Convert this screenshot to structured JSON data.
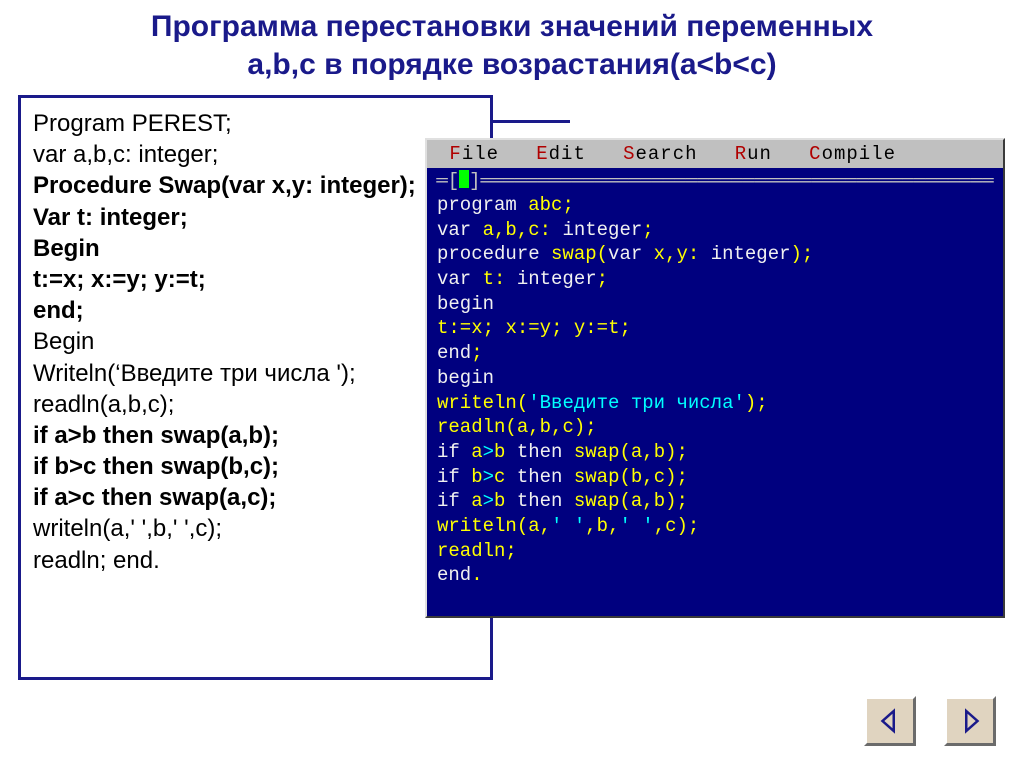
{
  "title_line1": "Программа перестановки значений переменных",
  "title_line2": "a,b,c в порядке возрастания(a<b<c)",
  "left_code": [
    {
      "text": "Program PEREST;",
      "bold": false
    },
    {
      "text": "var a,b,c: integer;",
      "bold": false
    },
    {
      "text": "Procedure Swap(var x,y: integer);",
      "bold": true
    },
    {
      "text": "Var t: integer;",
      "bold": true
    },
    {
      "text": "Begin",
      "bold": true
    },
    {
      "text": "t:=x; x:=y; y:=t;",
      "bold": true
    },
    {
      "text": "end;",
      "bold": true
    },
    {
      "text": "Begin",
      "bold": false
    },
    {
      "text": "Writeln(‘Введите три числа ');",
      "bold": false
    },
    {
      "text": "readln(a,b,c);",
      "bold": false
    },
    {
      "text": "if a>b then swap(a,b);",
      "bold": true
    },
    {
      "text": "if b>c then swap(b,c);",
      "bold": true
    },
    {
      "text": "if a>c then swap(a,c);",
      "bold": true
    },
    {
      "text": "writeln(a,' ',b,' ',c);",
      "bold": false
    },
    {
      "text": "readln;  end.",
      "bold": false
    }
  ],
  "ide": {
    "menu": [
      "File",
      "Edit",
      "Search",
      "Run",
      "Compile"
    ],
    "frame_char": "═",
    "cursor_glyph": " ",
    "lines": [
      [
        [
          "kw",
          "program "
        ],
        [
          "id",
          "abc"
        ],
        [
          "sym",
          ";"
        ]
      ],
      [
        [
          "kw",
          "var "
        ],
        [
          "id",
          "a"
        ],
        [
          "sym",
          ","
        ],
        [
          "id",
          "b"
        ],
        [
          "sym",
          ","
        ],
        [
          "id",
          "c"
        ],
        [
          "sym",
          ": "
        ],
        [
          "kw",
          "integer"
        ],
        [
          "sym",
          ";"
        ]
      ],
      [
        [
          "kw",
          "procedure "
        ],
        [
          "id",
          "swap"
        ],
        [
          "sym",
          "("
        ],
        [
          "kw",
          "var "
        ],
        [
          "id",
          "x"
        ],
        [
          "sym",
          ","
        ],
        [
          "id",
          "y"
        ],
        [
          "sym",
          ": "
        ],
        [
          "kw",
          "integer"
        ],
        [
          "sym",
          ");"
        ]
      ],
      [
        [
          "kw",
          "var "
        ],
        [
          "id",
          "t"
        ],
        [
          "sym",
          ": "
        ],
        [
          "kw",
          "integer"
        ],
        [
          "sym",
          ";"
        ]
      ],
      [
        [
          "kw",
          "begin"
        ]
      ],
      [
        [
          "id",
          "t"
        ],
        [
          "sym",
          ":="
        ],
        [
          "id",
          "x"
        ],
        [
          "sym",
          "; "
        ],
        [
          "id",
          "x"
        ],
        [
          "sym",
          ":="
        ],
        [
          "id",
          "y"
        ],
        [
          "sym",
          "; "
        ],
        [
          "id",
          "y"
        ],
        [
          "sym",
          ":="
        ],
        [
          "id",
          "t"
        ],
        [
          "sym",
          ";"
        ]
      ],
      [
        [
          "kw",
          "end"
        ],
        [
          "sym",
          ";"
        ]
      ],
      [
        [
          "kw",
          "begin"
        ]
      ],
      [
        [
          "id",
          "writeln"
        ],
        [
          "sym",
          "("
        ],
        [
          "str",
          "'Введите три числа'"
        ],
        [
          "sym",
          ");"
        ]
      ],
      [
        [
          "id",
          "readln"
        ],
        [
          "sym",
          "("
        ],
        [
          "id",
          "a"
        ],
        [
          "sym",
          ","
        ],
        [
          "id",
          "b"
        ],
        [
          "sym",
          ","
        ],
        [
          "id",
          "c"
        ],
        [
          "sym",
          ");"
        ]
      ],
      [
        [
          "kw",
          "if "
        ],
        [
          "id",
          "a"
        ],
        [
          "op",
          ">"
        ],
        [
          "id",
          "b"
        ],
        [
          "kw",
          " then "
        ],
        [
          "id",
          "swap"
        ],
        [
          "sym",
          "("
        ],
        [
          "id",
          "a"
        ],
        [
          "sym",
          ","
        ],
        [
          "id",
          "b"
        ],
        [
          "sym",
          ");"
        ]
      ],
      [
        [
          "kw",
          "if "
        ],
        [
          "id",
          "b"
        ],
        [
          "op",
          ">"
        ],
        [
          "id",
          "c"
        ],
        [
          "kw",
          " then "
        ],
        [
          "id",
          "swap"
        ],
        [
          "sym",
          "("
        ],
        [
          "id",
          "b"
        ],
        [
          "sym",
          ","
        ],
        [
          "id",
          "c"
        ],
        [
          "sym",
          ");"
        ]
      ],
      [
        [
          "kw",
          "if "
        ],
        [
          "id",
          "a"
        ],
        [
          "op",
          ">"
        ],
        [
          "id",
          "b"
        ],
        [
          "kw",
          " then "
        ],
        [
          "id",
          "swap"
        ],
        [
          "sym",
          "("
        ],
        [
          "id",
          "a"
        ],
        [
          "sym",
          ","
        ],
        [
          "id",
          "b"
        ],
        [
          "sym",
          ");"
        ]
      ],
      [
        [
          "id",
          "writeln"
        ],
        [
          "sym",
          "("
        ],
        [
          "id",
          "a"
        ],
        [
          "sym",
          ","
        ],
        [
          "str",
          "' '"
        ],
        [
          "sym",
          ","
        ],
        [
          "id",
          "b"
        ],
        [
          "sym",
          ","
        ],
        [
          "str",
          "' '"
        ],
        [
          "sym",
          ","
        ],
        [
          "id",
          "c"
        ],
        [
          "sym",
          ");"
        ]
      ],
      [
        [
          "id",
          "readln"
        ],
        [
          "sym",
          ";"
        ]
      ],
      [
        [
          "kw",
          "end"
        ],
        [
          "sym",
          "."
        ]
      ]
    ]
  }
}
